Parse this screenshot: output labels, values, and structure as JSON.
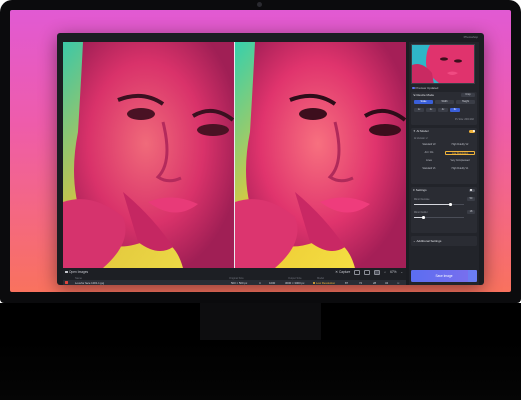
{
  "app": {
    "title": "Photoshop"
  },
  "viewer": {
    "left_label": "Original",
    "right_label": "Enhanced"
  },
  "toolbar": {
    "open_images": "Open Images",
    "capture": "Capture",
    "zoom": "67%"
  },
  "file_table": {
    "headers": [
      "Name",
      "Original Size",
      "Output Size",
      "Model"
    ],
    "row": {
      "name": "Lovefor face 1001.1.jpg",
      "original_size": "500 × 500 px",
      "scale": "4",
      "output_w": "1000",
      "output_size": "3000 × 3000 px",
      "model": "Low Resolution",
      "vals": [
        "87",
        "72",
        "28",
        "34"
      ]
    }
  },
  "sidebar": {
    "preview_label": "Preview Updated",
    "resize": {
      "title": "Resize Mode",
      "crop": "Crop",
      "modes": [
        "Scale",
        "Width",
        "Height"
      ],
      "scales": [
        "1x",
        "2x",
        "4x",
        "6x"
      ],
      "size_hint": "Px Size: 200×192"
    },
    "ai_model": {
      "title": "AI Model",
      "version": "AI Version: 2",
      "options": [
        [
          "Standard V2",
          "High Fidelity V2"
        ],
        [
          "Art / CG",
          "Low Resolution"
        ],
        [
          "Lines",
          "Very Compressed"
        ],
        [
          "Standard V1",
          "High Fidelity V1"
        ]
      ],
      "selected": "Low Resolution"
    },
    "settings": {
      "title": "Settings",
      "minor_denoise_label": "Minor Denoise",
      "minor_denoise": "50",
      "minor_deblur_label": "Minor Deblur",
      "minor_deblur": "18",
      "additional": "Additional Settings"
    },
    "save": "Save Image"
  },
  "colors": {
    "accent": "#5b6ef0",
    "selected": "#f0b33a",
    "background_top": "#e15ad3",
    "background_bottom": "#f9725e"
  }
}
